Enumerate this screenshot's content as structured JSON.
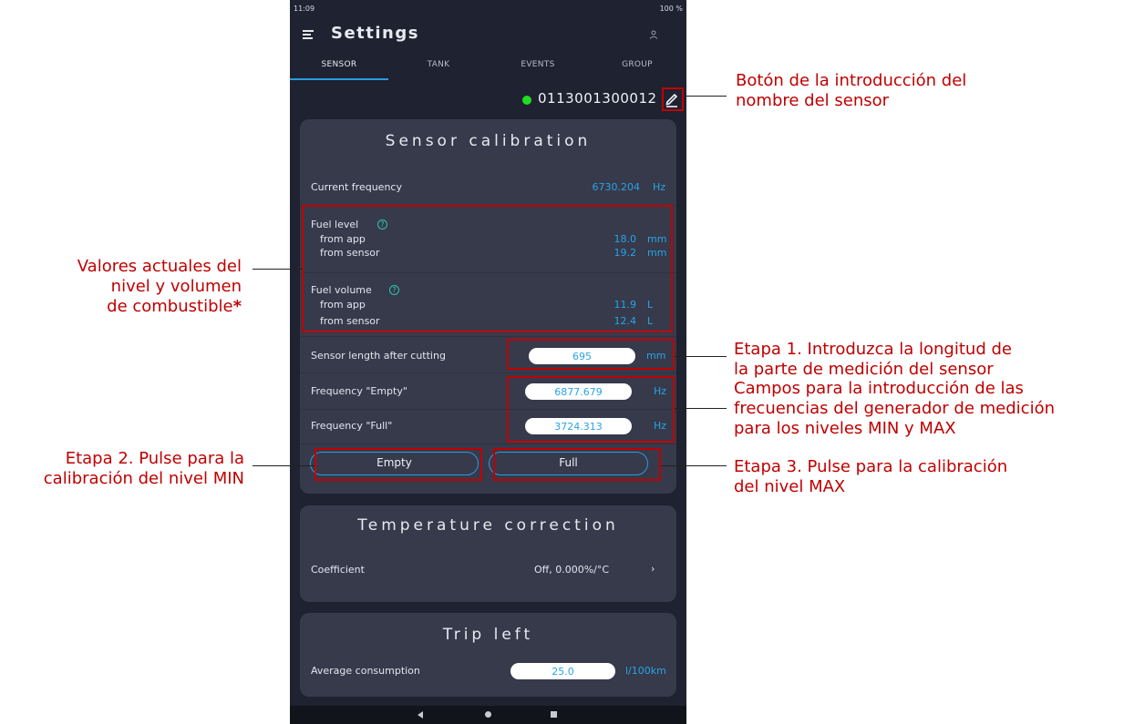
{
  "status_bar": {
    "time": "11:09",
    "right": "100 %"
  },
  "header": {
    "title": "Settings"
  },
  "tabs": [
    {
      "label": "SENSOR",
      "active": true
    },
    {
      "label": "TANK",
      "active": false
    },
    {
      "label": "EVENTS",
      "active": false
    },
    {
      "label": "GROUP",
      "active": false
    }
  ],
  "sensor": {
    "id": "0113001300012",
    "status_color": "#22dd22"
  },
  "calibration": {
    "title": "Sensor calibration",
    "current_frequency": {
      "label": "Current frequency",
      "value": "6730.204",
      "unit": "Hz"
    },
    "fuel_level": {
      "label": "Fuel level",
      "from_app": {
        "label": "from app",
        "value": "18.0",
        "unit": "mm"
      },
      "from_sensor": {
        "label": "from sensor",
        "value": "19.2",
        "unit": "mm"
      }
    },
    "fuel_volume": {
      "label": "Fuel volume",
      "from_app": {
        "label": "from app",
        "value": "11.9",
        "unit": "L"
      },
      "from_sensor": {
        "label": "from sensor",
        "value": "12.4",
        "unit": "L"
      }
    },
    "sensor_length": {
      "label": "Sensor length after cutting",
      "value": "695",
      "unit": "mm"
    },
    "freq_empty": {
      "label": "Frequency \"Empty\"",
      "value": "6877.679",
      "unit": "Hz"
    },
    "freq_full": {
      "label": "Frequency \"Full\"",
      "value": "3724.313",
      "unit": "Hz"
    },
    "empty_button": "Empty",
    "full_button": "Full"
  },
  "temperature": {
    "title": "Temperature correction",
    "coefficient_label": "Coefficient",
    "coefficient_value": "Off, 0.000%/°C"
  },
  "trip": {
    "title": "Trip left",
    "avg_label": "Average consumption",
    "avg_value": "25.0",
    "avg_unit": "l/100km"
  },
  "annotations": {
    "edit_name": [
      "Botón de la introducción del",
      "nombre del sensor"
    ],
    "current_values": [
      "Valores actuales del",
      "nivel y volumen",
      "de combustible"
    ],
    "asterisk": "*",
    "step1": [
      "Etapa 1. Introduzca la longitud de",
      "la parte de medición del sensor"
    ],
    "freq_fields": [
      "Campos para la introducción de las",
      "frecuencias del generador de medición",
      "para los niveles MIN y MAX"
    ],
    "step2": [
      "Etapa 2. Pulse para la",
      "calibración del nivel MIN"
    ],
    "step3": [
      "Etapa 3. Pulse para la calibración",
      "del nivel MAX"
    ]
  },
  "colors": {
    "accent": "#29a3e6",
    "annotation": "#c00000",
    "background": "#1f2230",
    "card": "#363a4b"
  }
}
